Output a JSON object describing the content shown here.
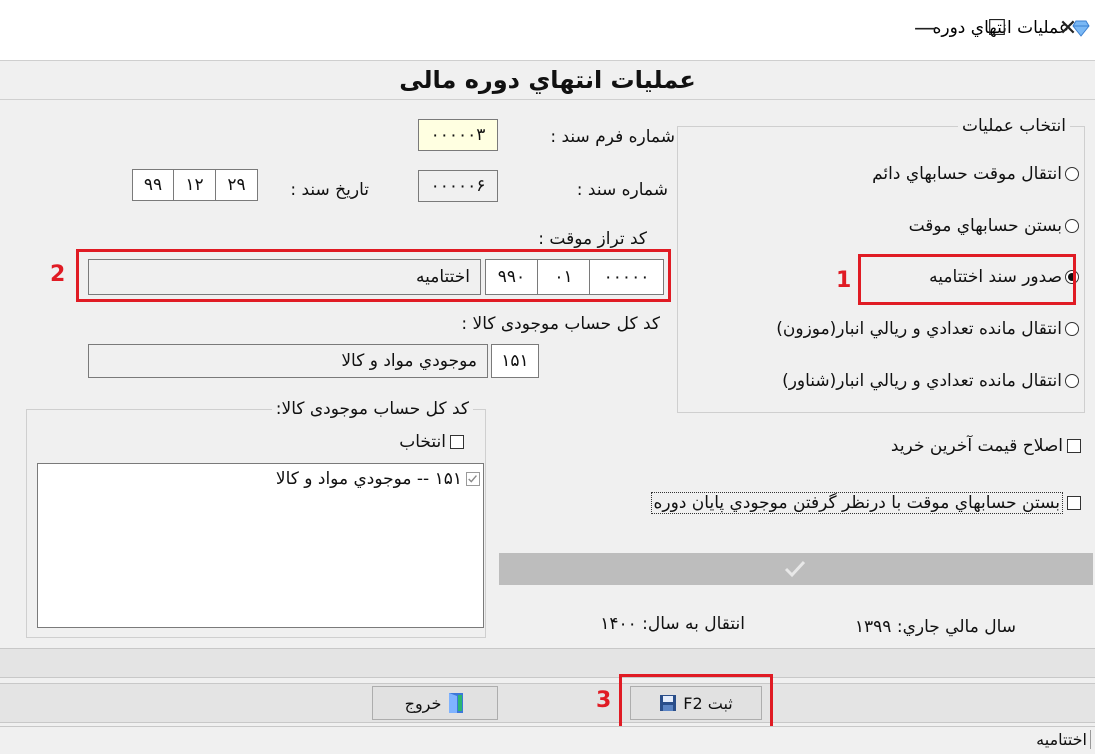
{
  "window": {
    "title": "عمليات انتهاي دوره",
    "minimize": "—",
    "maximize": "☐",
    "close": "✕"
  },
  "header": {
    "title": "عمليات انتهاي دوره مالی"
  },
  "fields": {
    "form_number_label": "شماره فرم سند :",
    "form_number_value": "۰۰۰۰۰۳",
    "doc_number_label": "شماره سند :",
    "doc_number_value": "۰۰۰۰۰۶",
    "doc_date_label": "تاريخ سند :",
    "doc_date": {
      "day": "۲۹",
      "month": "۱۲",
      "year": "۹۹"
    },
    "temp_balance_label": "کد تراز موقت :",
    "temp_balance": {
      "code1": "۰۰۰۰۰",
      "code2": "۰۱",
      "code3": "۹۹۰",
      "name": "اختتاميه"
    },
    "inventory_account_label": "کد کل حساب موجودی کالا :",
    "inventory_account": {
      "code": "۱۵۱",
      "name": "موجودي مواد و کالا"
    }
  },
  "operations": {
    "title": "انتخاب عمليات",
    "options": [
      {
        "label": "انتقال موقت حسابهاي دائم",
        "selected": false
      },
      {
        "label": "بستن حسابهاي موقت",
        "selected": false
      },
      {
        "label": "صدور سند اختتاميه",
        "selected": true
      },
      {
        "label": "انتقال مانده تعدادي و ريالي انبار(موزون)",
        "selected": false
      },
      {
        "label": "انتقال مانده تعدادي و ريالي انبار(شناور)",
        "selected": false
      }
    ]
  },
  "inventory_group": {
    "title": "کد کل حساب موجودی کالا:",
    "select_label": "انتخاب",
    "items": [
      {
        "label": "۱۵۱ -- موجودي مواد و کالا",
        "checked": true
      }
    ]
  },
  "options": {
    "fix_last_price": "اصلاح قيمت آخرين خريد",
    "close_with_inventory": "بستن حسابهاي موقت با درنظر گرفتن موجودي پايان دوره"
  },
  "progress": {
    "fraction": 0
  },
  "years": {
    "current_label": "سال مالي جاري: ۱۳۹۹",
    "transfer_label": "انتقال به سال: ۱۴۰۰"
  },
  "buttons": {
    "save": "ثبت F2",
    "exit": "خروج"
  },
  "status": {
    "text": "اختتاميه"
  },
  "annotations": {
    "n1": "1",
    "n2": "2",
    "n3": "3"
  },
  "colors": {
    "highlight": "#e01b24",
    "yellow_field": "#ffffe1"
  },
  "icons": {
    "app": "diamond-icon",
    "save": "floppy-disk-icon",
    "exit": "door-exit-icon",
    "progress": "checkmark-icon"
  }
}
